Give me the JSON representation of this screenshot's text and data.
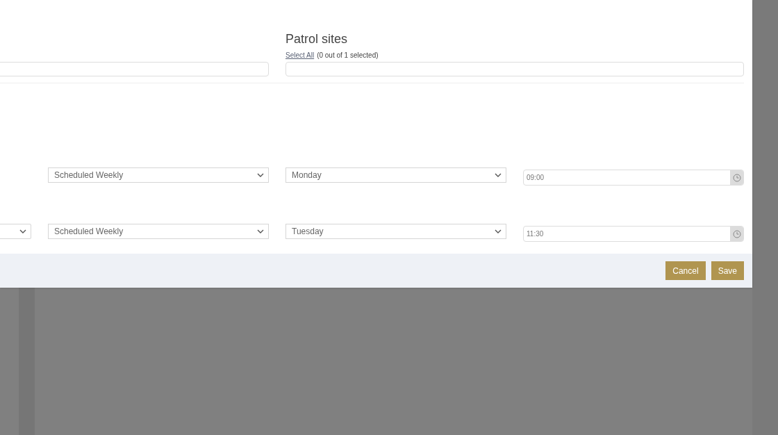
{
  "patrol_sites": {
    "title": "Patrol sites",
    "select_all": "Select All",
    "selection_count": "(0 out of 1 selected)"
  },
  "schedule_rows": [
    {
      "column_1": null,
      "frequency": "Scheduled Weekly",
      "day": "Monday",
      "time": "09:00"
    },
    {
      "column_1": "",
      "frequency": "Scheduled Weekly",
      "day": "Tuesday",
      "time": "11:30"
    }
  ],
  "buttons": [
    "Cancel",
    "Save"
  ]
}
